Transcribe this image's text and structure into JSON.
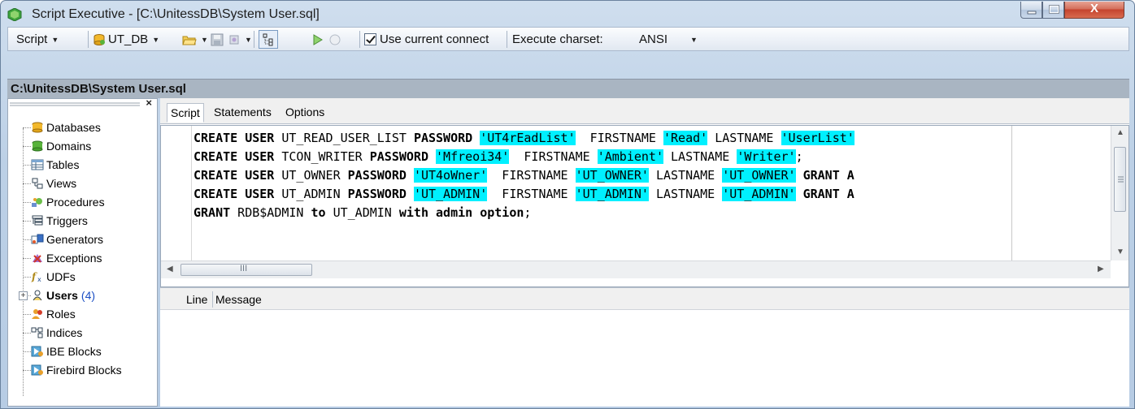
{
  "window": {
    "title": "Script Executive - [C:\\UnitessDB\\System User.sql]",
    "controls": {
      "minimize": "minimize-icon",
      "maximize": "maximize-icon",
      "close": "X"
    }
  },
  "toolbar": {
    "script_label": "Script",
    "db_label": "UT_DB",
    "use_current_connection": {
      "label": "Use current connect",
      "checked": true
    },
    "charset_label": "Execute charset:",
    "charset_value": "ANSI"
  },
  "path": "C:\\UnitessDB\\System User.sql",
  "tree": {
    "items": [
      {
        "label": "Databases",
        "icon": "database-icon"
      },
      {
        "label": "Domains",
        "icon": "domain-icon"
      },
      {
        "label": "Tables",
        "icon": "table-icon"
      },
      {
        "label": "Views",
        "icon": "view-icon"
      },
      {
        "label": "Procedures",
        "icon": "procedure-icon"
      },
      {
        "label": "Triggers",
        "icon": "trigger-icon"
      },
      {
        "label": "Generators",
        "icon": "generator-icon"
      },
      {
        "label": "Exceptions",
        "icon": "exception-icon"
      },
      {
        "label": "UDFs",
        "icon": "udf-icon"
      },
      {
        "label": "Users",
        "icon": "user-icon",
        "count": "(4)",
        "expandable": true
      },
      {
        "label": "Roles",
        "icon": "role-icon"
      },
      {
        "label": "Indices",
        "icon": "index-icon"
      },
      {
        "label": "IBE Blocks",
        "icon": "ibe-block-icon"
      },
      {
        "label": "Firebird Blocks",
        "icon": "firebird-block-icon"
      }
    ]
  },
  "tabs": [
    "Script",
    "Statements",
    "Options"
  ],
  "editor": {
    "lines": [
      [
        [
          "kw",
          "CREATE USER"
        ],
        [
          "t",
          " UT_READ_USER_LIST "
        ],
        [
          "kw",
          "PASSWORD"
        ],
        [
          "t",
          " "
        ],
        [
          "s",
          "'UT4rEadList'"
        ],
        [
          "t",
          "  FIRSTNAME "
        ],
        [
          "s",
          "'Read'"
        ],
        [
          "t",
          " LASTNAME "
        ],
        [
          "s",
          "'UserList'"
        ],
        [
          "t",
          " "
        ]
      ],
      [
        [
          "kw",
          "CREATE USER"
        ],
        [
          "t",
          " TCON_WRITER "
        ],
        [
          "kw",
          "PASSWORD"
        ],
        [
          "t",
          " "
        ],
        [
          "s",
          "'Mfreoi34'"
        ],
        [
          "t",
          "  FIRSTNAME "
        ],
        [
          "s",
          "'Ambient'"
        ],
        [
          "t",
          " LASTNAME "
        ],
        [
          "s",
          "'Writer'"
        ],
        [
          "t",
          ";"
        ]
      ],
      [
        [
          "kw",
          "CREATE USER"
        ],
        [
          "t",
          " UT_OWNER "
        ],
        [
          "kw",
          "PASSWORD"
        ],
        [
          "t",
          " "
        ],
        [
          "s",
          "'UT4oWner'"
        ],
        [
          "t",
          "  FIRSTNAME "
        ],
        [
          "s",
          "'UT_OWNER'"
        ],
        [
          "t",
          " LASTNAME "
        ],
        [
          "s",
          "'UT_OWNER'"
        ],
        [
          "t",
          " "
        ],
        [
          "kw",
          "GRANT A"
        ]
      ],
      [
        [
          "kw",
          "CREATE USER"
        ],
        [
          "t",
          " UT_ADMIN "
        ],
        [
          "kw",
          "PASSWORD"
        ],
        [
          "t",
          " "
        ],
        [
          "s",
          "'UT_ADMIN'"
        ],
        [
          "t",
          "  FIRSTNAME "
        ],
        [
          "s",
          "'UT_ADMIN'"
        ],
        [
          "t",
          " LASTNAME "
        ],
        [
          "s",
          "'UT_ADMIN'"
        ],
        [
          "t",
          " "
        ],
        [
          "kw",
          "GRANT A"
        ]
      ],
      [
        [
          "kw",
          "GRANT"
        ],
        [
          "t",
          " RDB$ADMIN "
        ],
        [
          "kw",
          "to"
        ],
        [
          "t",
          " UT_ADMIN "
        ],
        [
          "kw",
          "with admin option"
        ],
        [
          "t",
          ";"
        ]
      ]
    ],
    "hscroll_marker": "III"
  },
  "messages": {
    "columns": [
      "Line",
      "Message"
    ]
  }
}
